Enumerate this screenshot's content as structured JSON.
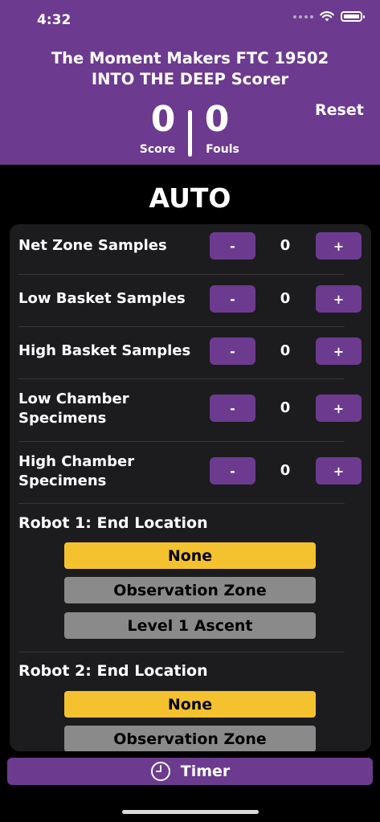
{
  "status_bar": {
    "time": "4:32",
    "icons": [
      "signal-dots-icon",
      "wifi-icon",
      "battery-icon"
    ]
  },
  "header": {
    "title_line1": "The Moment Makers FTC 19502",
    "title_line2": "INTO THE DEEP Scorer",
    "score_value": "0",
    "score_label": "Score",
    "fouls_value": "0",
    "fouls_label": "Fouls",
    "reset_label": "Reset"
  },
  "mode_title": "AUTO",
  "counters": [
    {
      "label_line1": "Net Zone Samples",
      "label_line2": "",
      "minus": "-",
      "plus": "+",
      "value": "0"
    },
    {
      "label_line1": "Low Basket Samples",
      "label_line2": "",
      "minus": "-",
      "plus": "+",
      "value": "0"
    },
    {
      "label_line1": "High Basket Samples",
      "label_line2": "",
      "minus": "-",
      "plus": "+",
      "value": "0"
    },
    {
      "label_line1": "Low Chamber",
      "label_line2": "Specimens",
      "minus": "-",
      "plus": "+",
      "value": "0"
    },
    {
      "label_line1": "High Chamber",
      "label_line2": "Specimens",
      "minus": "-",
      "plus": "+",
      "value": "0"
    }
  ],
  "robot1": {
    "label": "Robot 1: End Location",
    "options": [
      "None",
      "Observation Zone",
      "Level 1 Ascent"
    ],
    "selected": "None"
  },
  "robot2": {
    "label": "Robot 2: End Location",
    "options": [
      "None",
      "Observation Zone"
    ],
    "selected": "None"
  },
  "timer": {
    "label": "Timer",
    "icon": "clock-icon"
  },
  "colors": {
    "accent": "#6c3a8f",
    "selected": "#f4c12f",
    "unselected": "#8a8a8a",
    "card": "#1c1c1e"
  }
}
